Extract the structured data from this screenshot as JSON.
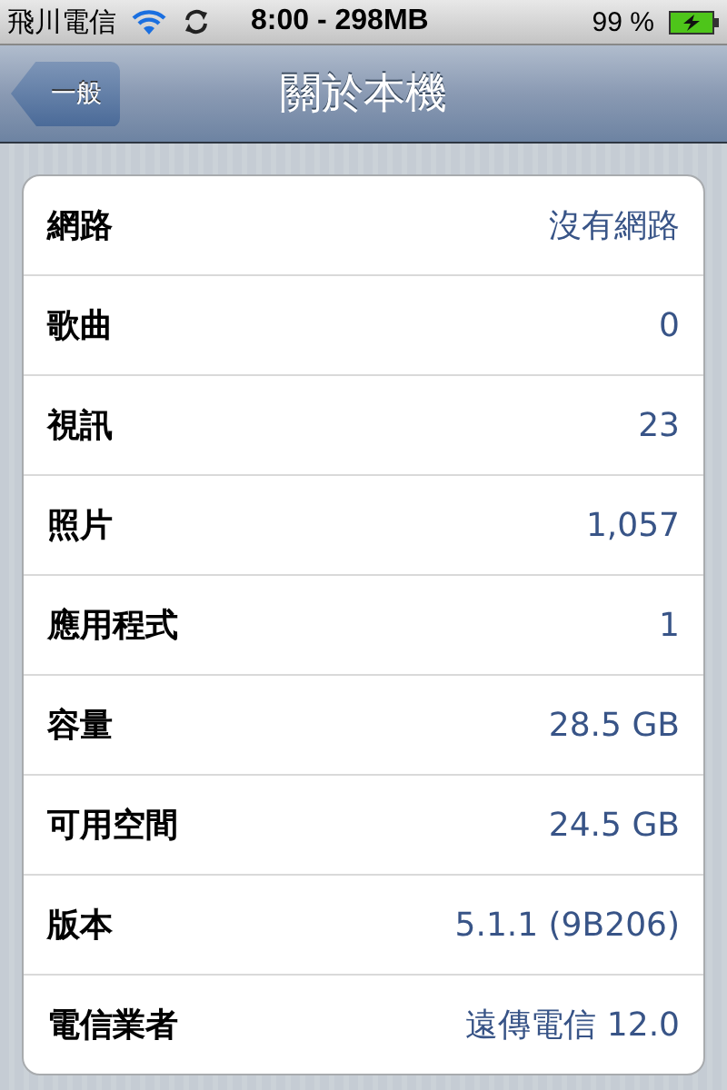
{
  "status_bar": {
    "carrier": "飛川電信",
    "center": "8:00 - 298MB",
    "battery": "99 %"
  },
  "nav_bar": {
    "back": "一般",
    "title": "關於本機"
  },
  "rows": [
    {
      "label": "網路",
      "value": "沒有網路"
    },
    {
      "label": "歌曲",
      "value": "0"
    },
    {
      "label": "視訊",
      "value": "23"
    },
    {
      "label": "照片",
      "value": "1,057"
    },
    {
      "label": "應用程式",
      "value": "1"
    },
    {
      "label": "容量",
      "value": "28.5 GB"
    },
    {
      "label": "可用空間",
      "value": "24.5 GB"
    },
    {
      "label": "版本",
      "value": "5.1.1 (9B206)"
    },
    {
      "label": "電信業者",
      "value": "遠傳電信 12.0"
    }
  ]
}
